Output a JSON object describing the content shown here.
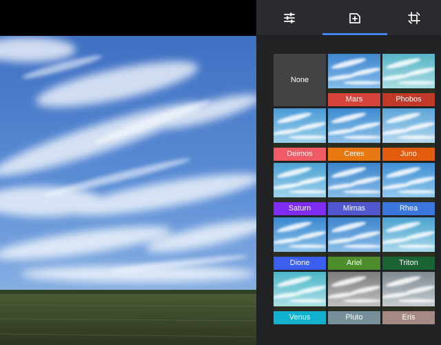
{
  "tabs": [
    {
      "id": "adjust",
      "icon": "tune-sliders-icon",
      "active": false
    },
    {
      "id": "filters",
      "icon": "filter-plus-icon",
      "active": true
    },
    {
      "id": "crop",
      "icon": "crop-rotate-icon",
      "active": false
    }
  ],
  "colors": {
    "panel_bg": "#212224",
    "tab_bar_bg": "#2a2b2e",
    "active_indicator": "#4285f4",
    "none_tile_bg": "#434446"
  },
  "filters": {
    "none_label": "None",
    "items": [
      {
        "name": "Mars",
        "color": "#d6453c"
      },
      {
        "name": "Phobos",
        "color": "#c0392b"
      },
      {
        "name": "Deimos",
        "color": "#f05a64"
      },
      {
        "name": "Ceres",
        "color": "#e8770f"
      },
      {
        "name": "Juno",
        "color": "#e25c10"
      },
      {
        "name": "Saturn",
        "color": "#7e2bf2"
      },
      {
        "name": "Mimas",
        "color": "#5158cf"
      },
      {
        "name": "Rhea",
        "color": "#3a76de"
      },
      {
        "name": "Dione",
        "color": "#3c5ef0"
      },
      {
        "name": "Ariel",
        "color": "#4e8d2d"
      },
      {
        "name": "Triton",
        "color": "#1b6334"
      },
      {
        "name": "Venus",
        "color": "#0fb1cf"
      },
      {
        "name": "Pluto",
        "color": "#778f9a"
      },
      {
        "name": "Eris",
        "color": "#a48a82"
      }
    ]
  }
}
